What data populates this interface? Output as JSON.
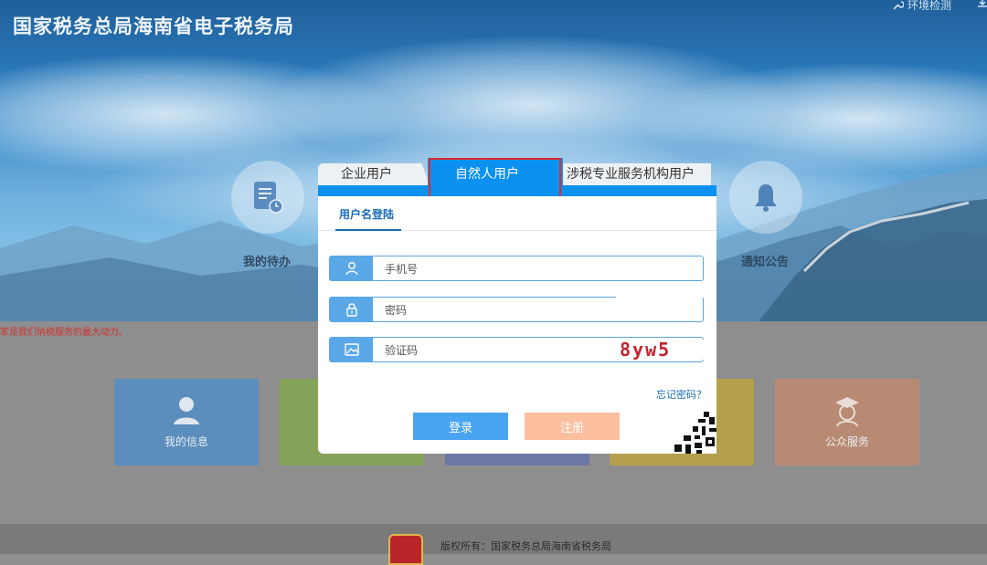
{
  "site": {
    "title": "国家税务总局海南省电子税务局",
    "env_check": "环境检测"
  },
  "background": {
    "circle_left_label": "我的待办",
    "circle_right_label": "通知公告",
    "slogan": "家是我们纳税服务的最大动力。",
    "tiles": [
      {
        "label": "我的信息",
        "color": "#5b9bd5"
      },
      {
        "label": "",
        "color": "#8fb45a"
      },
      {
        "label": "",
        "color": "#6f7fb5"
      },
      {
        "label": "",
        "color": "#c9b24c"
      },
      {
        "label": "公众服务",
        "color": "#d49a7c"
      }
    ],
    "footer": "版权所有：国家税务总局海南省税务局"
  },
  "dialog": {
    "tabs": {
      "enterprise": "企业用户",
      "natural": "自然人用户",
      "agency": "涉税专业服务机构用户"
    },
    "subtab": "用户名登陆",
    "fields": {
      "phone_placeholder": "手机号",
      "password_placeholder": "密码",
      "captcha_placeholder": "验证码"
    },
    "captcha_text": "8yw5",
    "forgot": "忘记密码？",
    "login": "登录",
    "register": "注册"
  },
  "colors": {
    "accent": "#0b91f0",
    "tab_highlight": "#e02a2a",
    "login_button": "#49a4f2",
    "register_button": "#fbbfa0"
  }
}
